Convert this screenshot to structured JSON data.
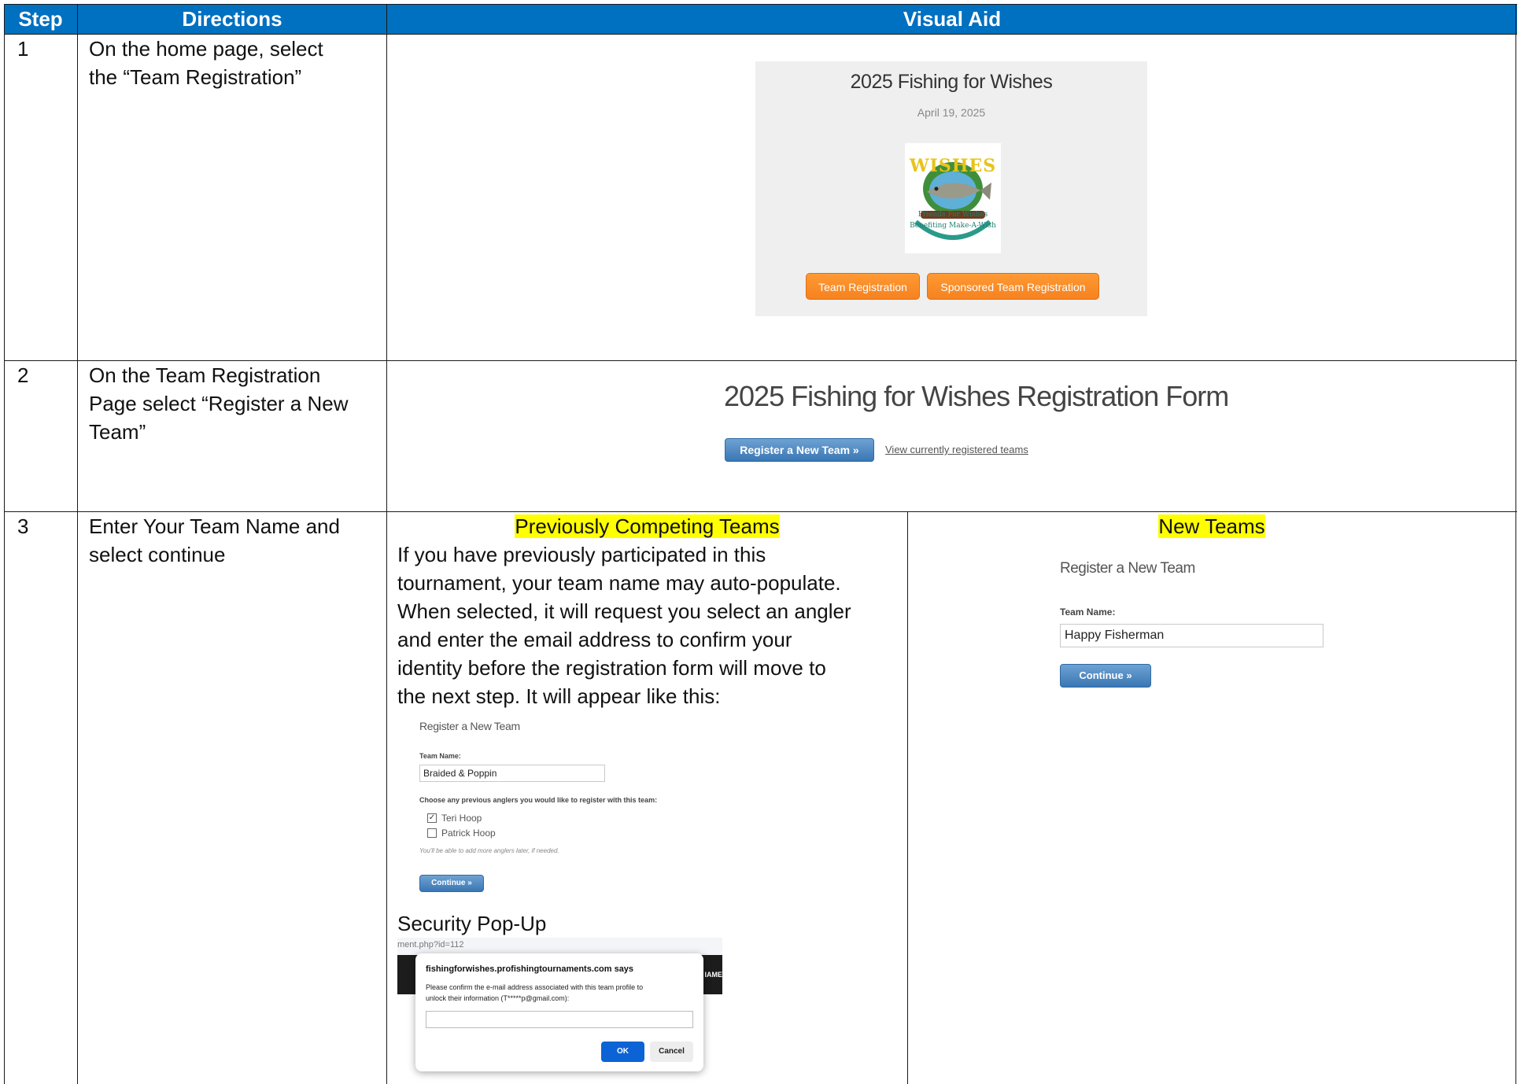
{
  "header": {
    "step": "Step",
    "directions": "Directions",
    "visual_aid": "Visual Aid"
  },
  "rows": [
    {
      "step": "1",
      "directions": [
        "On the home page, select",
        "the “Team Registration”"
      ],
      "card": {
        "title": "2025 Fishing for Wishes",
        "date": "April 19, 2025",
        "logo_text": [
          "Friends For Wishes",
          "Benefiting Make-A-Wish"
        ],
        "logo_banner": "WISHES",
        "buttons": [
          "Team Registration",
          "Sponsored Team Registration"
        ]
      }
    },
    {
      "step": "2",
      "directions": [
        "On the Team Registration",
        "Page select “Register a New",
        "Team”"
      ],
      "form_title": "2025 Fishing for Wishes Registration Form",
      "register_button": "Register a New Team »",
      "view_link": "View currently registered teams"
    },
    {
      "step": "3",
      "directions": [
        "Enter Your Team Name and",
        "select continue"
      ],
      "previous": {
        "heading": "Previously Competing Teams",
        "paragraph": [
          "If you have previously participated in this",
          "tournament, your team name may auto-populate.",
          "When selected, it will request you select an angler",
          "and enter the email address to confirm your",
          "identity before the registration form will move to",
          "the next step. It will appear like this:"
        ],
        "form": {
          "title": "Register a New Team",
          "team_label": "Team Name:",
          "team_value": "Braided & Poppin",
          "anglers_label": "Choose any previous anglers you would like to register with this team:",
          "anglers": [
            {
              "name": "Teri Hoop",
              "checked": true
            },
            {
              "name": "Patrick Hoop",
              "checked": false
            }
          ],
          "note": "You'll be able to add more anglers later, if needed.",
          "continue": "Continue »"
        },
        "popup_heading": "Security Pop-Up",
        "popup": {
          "url_fragment": "ment.php?id=112",
          "bar_fragment": "IAME",
          "site": "fishingforwishes.profishingtournaments.com says",
          "message": [
            "Please confirm the e-mail address associated with this team profile to",
            "unlock their information (T*****p@gmail.com):"
          ],
          "ok": "OK",
          "cancel": "Cancel"
        }
      },
      "new": {
        "heading": "New Teams",
        "form": {
          "title": "Register a New Team",
          "team_label": "Team Name:",
          "team_value": "Happy Fisherman",
          "continue": "Continue »"
        }
      }
    }
  ]
}
